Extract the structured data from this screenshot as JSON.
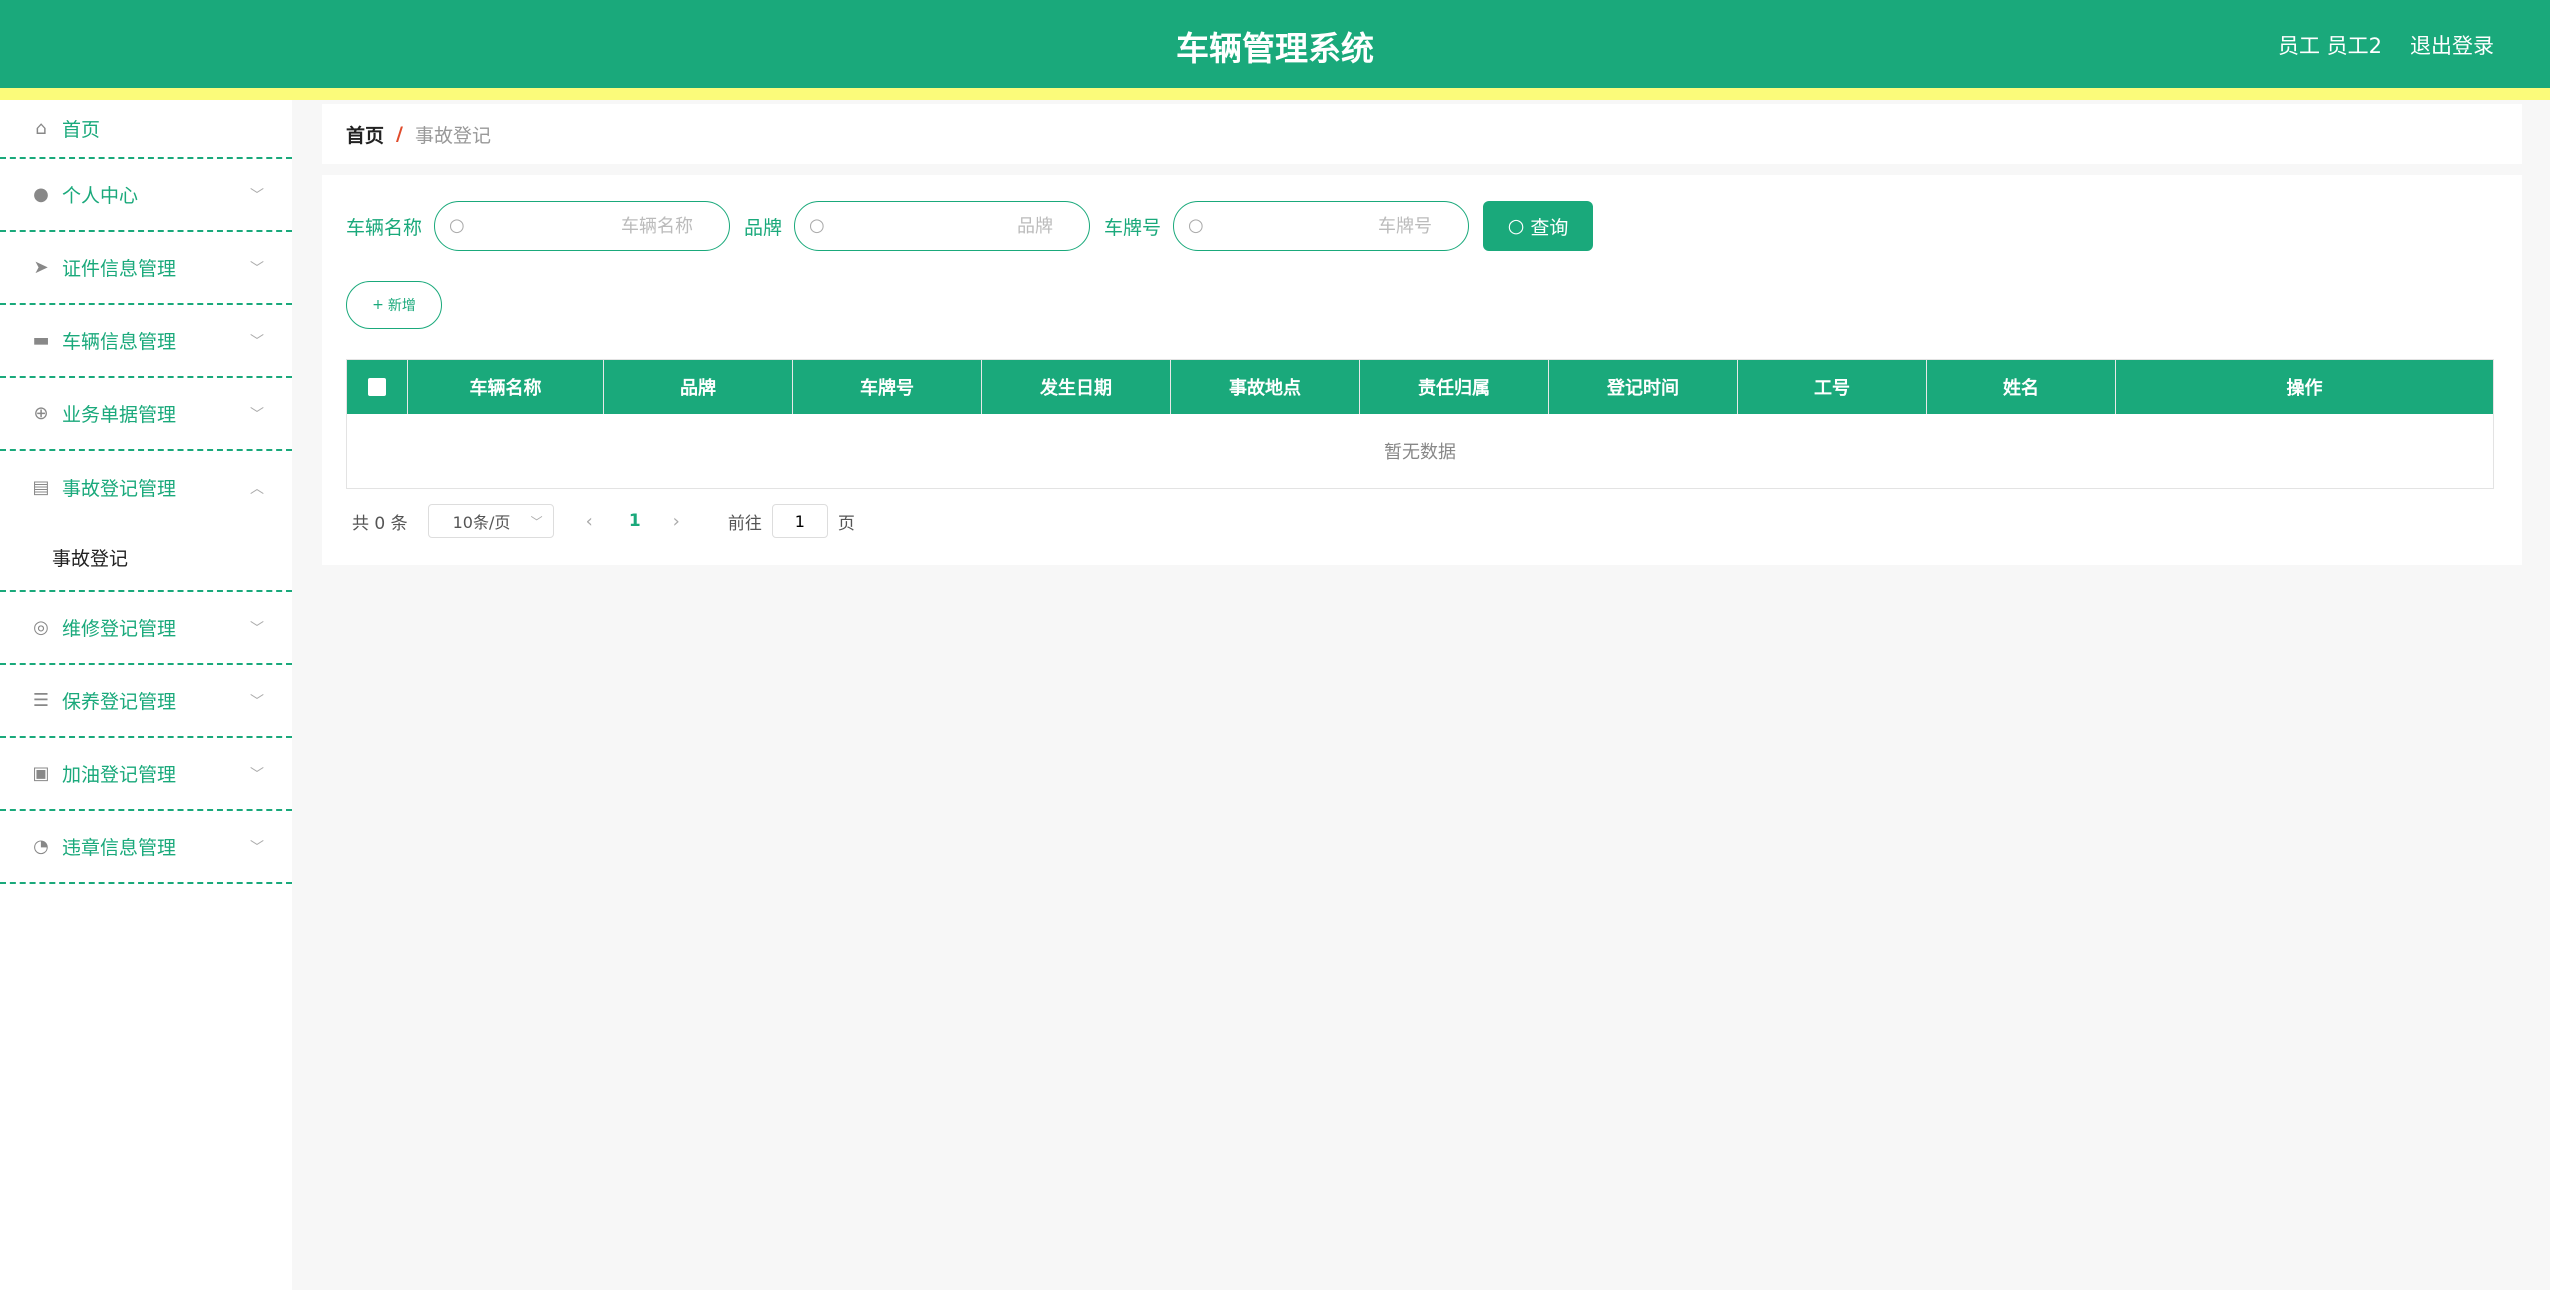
{
  "header": {
    "title": "车辆管理系统",
    "user_label": "员工 员工2",
    "logout_label": "退出登录"
  },
  "sidebar": {
    "items": [
      {
        "label": "首页",
        "icon": "home-icon"
      },
      {
        "label": "个人中心",
        "icon": "user-icon"
      },
      {
        "label": "证件信息管理",
        "icon": "send-icon"
      },
      {
        "label": "车辆信息管理",
        "icon": "monitor-icon"
      },
      {
        "label": "业务单据管理",
        "icon": "crosshair-icon"
      },
      {
        "label": "事故登记管理",
        "icon": "news-icon",
        "submenu": [
          {
            "label": "事故登记"
          }
        ]
      },
      {
        "label": "维修登记管理",
        "icon": "compass-icon"
      },
      {
        "label": "保养登记管理",
        "icon": "sliders-icon"
      },
      {
        "label": "加油登记管理",
        "icon": "clipboard-icon"
      },
      {
        "label": "违章信息管理",
        "icon": "gauge-icon"
      }
    ]
  },
  "breadcrumb": {
    "home": "首页",
    "separator": "/",
    "current": "事故登记"
  },
  "search": {
    "fields": [
      {
        "label": "车辆名称",
        "placeholder": "车辆名称"
      },
      {
        "label": "品牌",
        "placeholder": "品牌"
      },
      {
        "label": "车牌号",
        "placeholder": "车牌号"
      }
    ],
    "button_label": "查询"
  },
  "actions": {
    "add_label": "新增"
  },
  "table": {
    "columns": [
      "车辆名称",
      "品牌",
      "车牌号",
      "发生日期",
      "事故地点",
      "责任归属",
      "登记时间",
      "工号",
      "姓名",
      "操作"
    ],
    "empty_text": "暂无数据"
  },
  "pagination": {
    "total_text": "共 0 条",
    "page_size": "10条/页",
    "current_page": "1",
    "goto_label": "前往",
    "goto_value": "1",
    "page_suffix": "页"
  },
  "colors": {
    "primary": "#1aa97b",
    "header_stripe": "#fbfb7a"
  }
}
